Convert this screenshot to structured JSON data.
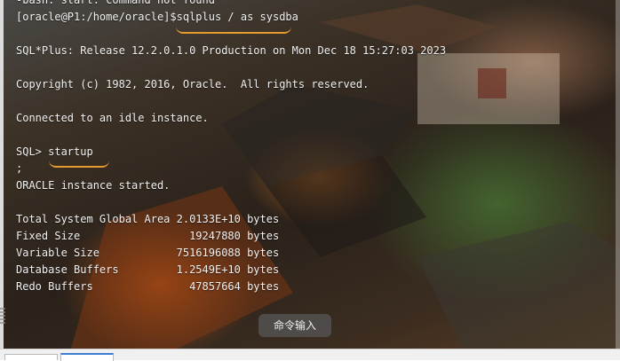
{
  "terminal": {
    "lines": [
      "-bash: start: command not found",
      "[oracle@P1:/home/oracle]$sqlplus / as sysdba",
      "",
      "SQL*Plus: Release 12.2.0.1.0 Production on Mon Dec 18 15:27:03 2023",
      "",
      "Copyright (c) 1982, 2016, Oracle.  All rights reserved.",
      "",
      "Connected to an idle instance.",
      "",
      "SQL> startup",
      ";",
      "ORACLE instance started.",
      "",
      "Total System Global Area 2.0133E+10 bytes",
      "Fixed Size                 19247880 bytes",
      "Variable Size            7516196088 bytes",
      "Database Buffers         1.2549E+10 bytes",
      "Redo Buffers               47857664 bytes"
    ]
  },
  "command_input": {
    "label": "命令输入"
  },
  "colors": {
    "text": "#f2f2f2",
    "annotation": "#e89a2f",
    "tab_active_accent": "#3c7fd1"
  }
}
